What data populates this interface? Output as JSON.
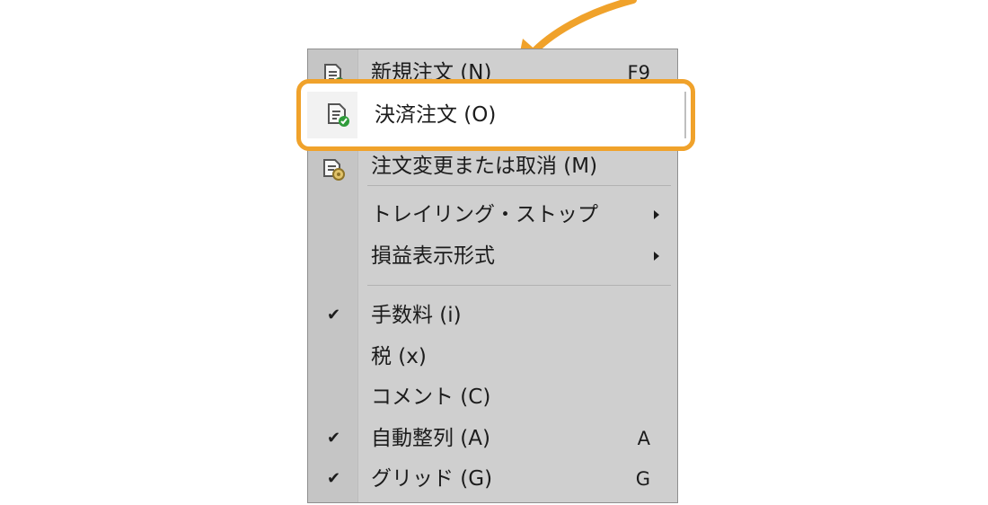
{
  "colors": {
    "accent": "#f0a22b",
    "menu_background": "#cfcfcf",
    "menu_gutter": "#c5c5c5",
    "text": "#1c1c1c"
  },
  "menu": {
    "items": [
      {
        "label": "新規注文 (N)",
        "shortcut": "F9",
        "icon": "new-order-icon"
      },
      {
        "label": "決済注文 (O)",
        "shortcut": "",
        "icon": "close-order-icon",
        "highlighted": true
      },
      {
        "label": "注文変更または取消 (M)",
        "shortcut": "",
        "icon": "modify-order-icon"
      },
      {
        "label": "トレイリング・ストップ",
        "submenu": true
      },
      {
        "label": "損益表示形式",
        "submenu": true
      },
      {
        "label": "手数料 (i)",
        "checked": true
      },
      {
        "label": "税 (x)",
        "checked": false
      },
      {
        "label": "コメント (C)",
        "checked": false
      },
      {
        "label": "自動整列 (A)",
        "shortcut": "A",
        "checked": true
      },
      {
        "label": "グリッド (G)",
        "shortcut": "G",
        "checked": true
      }
    ]
  },
  "icons": {
    "check": "✔",
    "pointer_arrow": "orange-curved-arrow-icon"
  }
}
